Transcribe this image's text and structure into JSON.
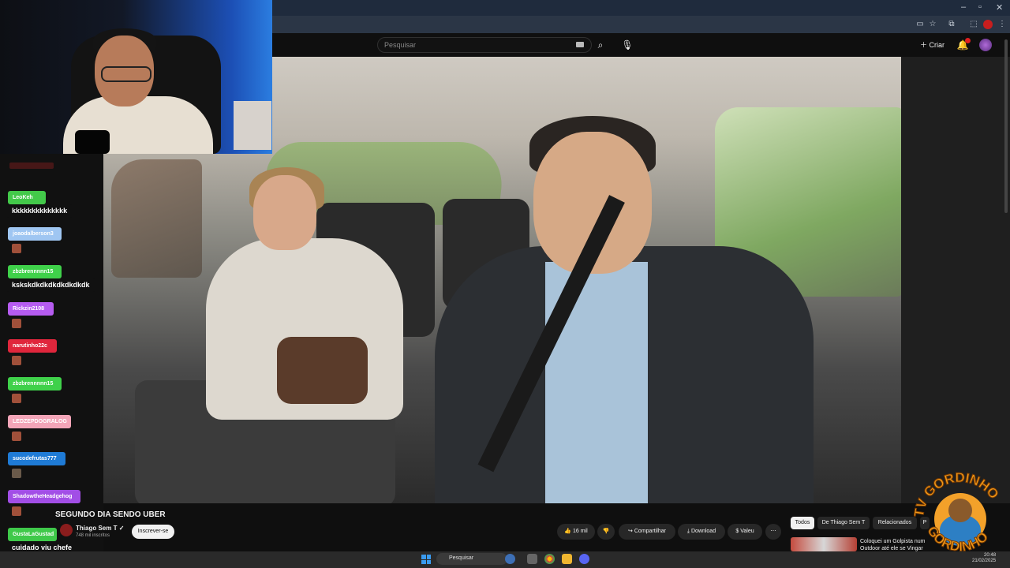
{
  "youtube": {
    "search_placeholder": "Pesquisar",
    "create_label": "Criar",
    "notification_count": "9+",
    "video_title": "SEGUNDO DIA SENDO UBER",
    "channel_name": "Thiago Sem T",
    "channel_subs": "748 mil inscritos",
    "subscribe_label": "Inscrever-se",
    "likes": "16 mil",
    "share_label": "Compartilhar",
    "download_label": "Download",
    "thanks_label": "Valeu",
    "chips": [
      "Todos",
      "De Thiago Sem T",
      "Relacionados",
      "P"
    ],
    "rec_title": "Coloquei um Golpista num Outdoor até ele se Vingar"
  },
  "chat": {
    "messages": [
      {
        "user": "LeoKeh",
        "color": "#43c94a",
        "text": "kkkkkkkkkkkkkk"
      },
      {
        "user": "joaodalberson3",
        "color": "#9fc6f2",
        "text": ""
      },
      {
        "user": "zbzbrennnnn15",
        "color": "#3fd14a",
        "text": "kskskdkdkdkdkdkdkdk"
      },
      {
        "user": "Rickzin2108",
        "color": "#b65cf0",
        "text": ""
      },
      {
        "user": "narutinho22c",
        "color": "#e0263c",
        "text": ""
      },
      {
        "user": "zbzbrennnnn15",
        "color": "#3fd14a",
        "text": ""
      },
      {
        "user": "LEDZEPDOGRALOG",
        "color": "#f3a5b8",
        "text": ""
      },
      {
        "user": "sucodefrutas777",
        "color": "#1f7bd6",
        "text": ""
      },
      {
        "user": "ShadowtheHeadgehog",
        "color": "#a24ee6",
        "text": ""
      },
      {
        "user": "GustaLaGustad",
        "color": "#3fc94a",
        "text": "cuidado viu chefe"
      }
    ]
  },
  "overlay_logo": {
    "text_top": "TV GORDINHO",
    "text_bottom": "GORDINHO"
  },
  "taskbar": {
    "search_label": "Pesquisar",
    "time": "20:48",
    "date": "21/02/2025"
  }
}
